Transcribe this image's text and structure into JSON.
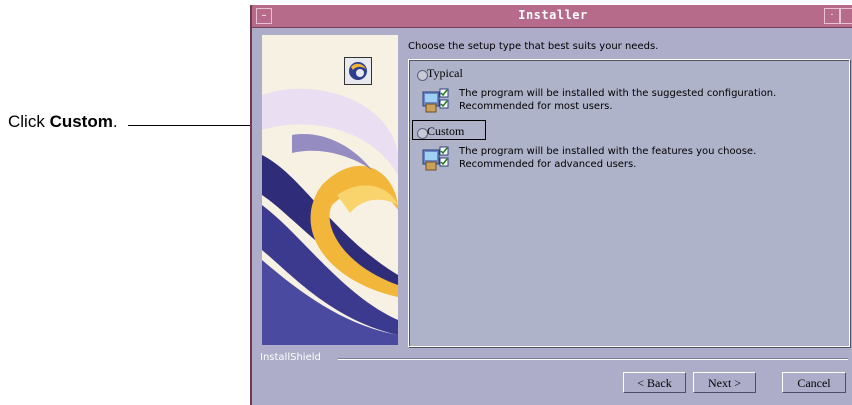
{
  "annotation": {
    "prefix": "Click ",
    "target": "Custom",
    "suffix": "."
  },
  "window": {
    "title": "Installer"
  },
  "instruction": "Choose the setup type that best suits your needs.",
  "options": [
    {
      "label": "Typical",
      "line1": "The program will be installed with the suggested configuration.",
      "line2": "Recommended for most users.",
      "selected": false
    },
    {
      "label": "Custom",
      "line1": "The program will be installed with the features you choose.",
      "line2": "Recommended for advanced users.",
      "selected": false
    }
  ],
  "footer": {
    "brand": "InstallShield"
  },
  "buttons": {
    "back": "< Back",
    "next": "Next >",
    "cancel": "Cancel"
  },
  "colors": {
    "titlebar": "#b76b8b",
    "window_bg": "#adadc9",
    "group_bg": "#aeb3ca"
  }
}
